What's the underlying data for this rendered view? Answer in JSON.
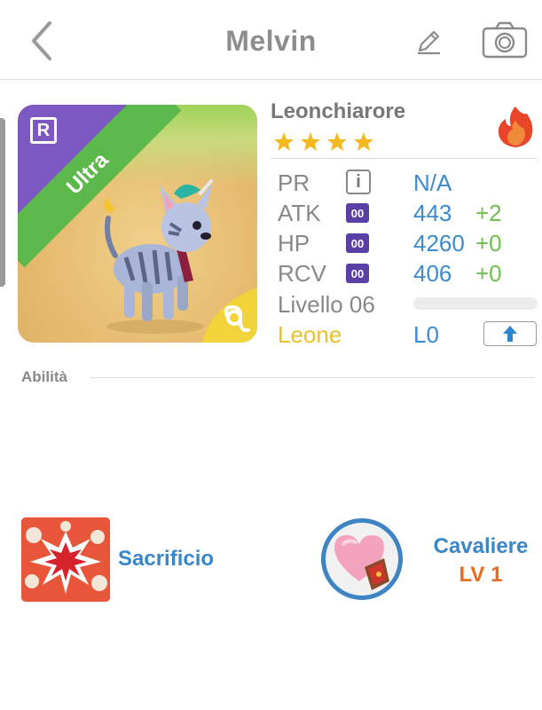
{
  "header": {
    "title": "Melvin",
    "back_icon": "chevron-left-icon",
    "edit_icon": "pencil-icon",
    "camera_icon": "camera-icon"
  },
  "card": {
    "rarity_badge": "R",
    "ribbon_text": "Ultra",
    "zodiac_icon": "leo-icon"
  },
  "pet": {
    "name": "Leonchiarore",
    "stars": 4,
    "element_icon": "fire-icon"
  },
  "stats": [
    {
      "label": "PR",
      "badge": "i",
      "value": "N/A",
      "bonus": ""
    },
    {
      "label": "ATK",
      "badge": "00",
      "value": "443",
      "bonus": "+2"
    },
    {
      "label": "HP",
      "badge": "00",
      "value": "4260",
      "bonus": "+0"
    },
    {
      "label": "RCV",
      "badge": "00",
      "value": "406",
      "bonus": "+0"
    }
  ],
  "level": {
    "label": "Livello 06",
    "progress": 0
  },
  "zodiac": {
    "label": "Leone",
    "level": "L0",
    "upgrade_icon": "arrow-up-icon"
  },
  "abilities": {
    "section_title": "Abilità",
    "items": [
      {
        "name": "Sacrificio",
        "icon": "explosion-icon"
      },
      {
        "name": "Cavaliere",
        "level": "LV 1",
        "icon": "heart-shield-icon"
      }
    ]
  },
  "colors": {
    "accent_blue": "#3b8bcf",
    "bonus_green": "#6ec24a",
    "zodiac_gold": "#e9c12a",
    "level_orange": "#e86a1c",
    "rarity_purple": "#7d57c2",
    "ribbon_green": "#5cb84a"
  }
}
